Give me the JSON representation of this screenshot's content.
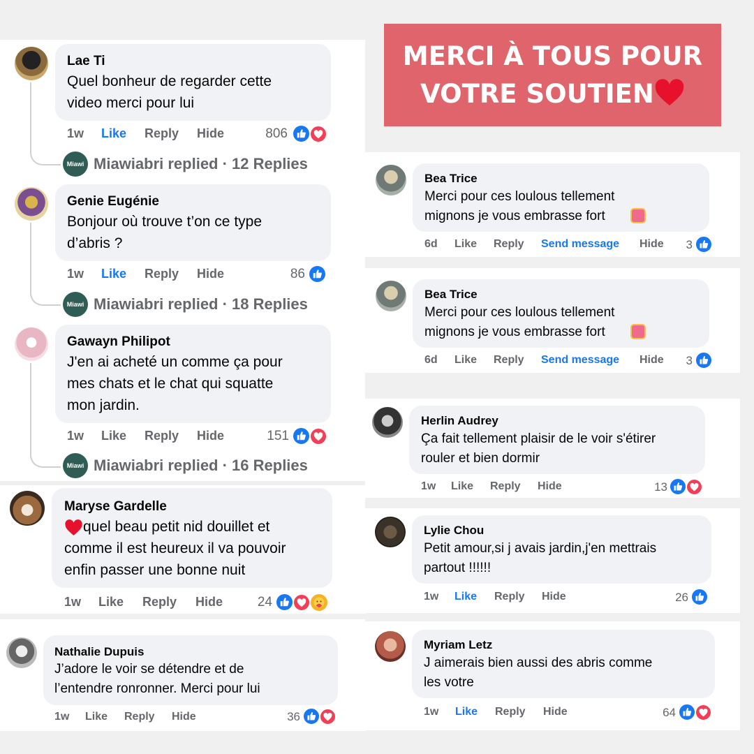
{
  "banner": {
    "line1": "MERCI À TOUS POUR",
    "line2": "VOTRE SOUTIEN",
    "heart_icon": "red-heart-emoji"
  },
  "comments": [
    {
      "name": "Lae Ti",
      "text": "Quel bonheur de regarder cette\nvideo merci pour lui",
      "time": "1w",
      "like": "Like",
      "reply": "Reply",
      "hide": "Hide",
      "count": "806",
      "reactions": [
        "like",
        "love"
      ],
      "replied": "Miawiabri replied · 12 Replies"
    },
    {
      "name": "Genie Eugénie",
      "text": "Bonjour où trouve t’on ce type\nd’abris ?",
      "time": "1w",
      "like": "Like",
      "reply": "Reply",
      "hide": "Hide",
      "count": "86",
      "reactions": [
        "like"
      ],
      "replied": "Miawiabri replied · 18 Replies"
    },
    {
      "name": "Gawayn Philipot",
      "text": "J'en ai acheté un comme ça pour\nmes chats et le chat qui squatte\nmon jardin.",
      "time": "1w",
      "like": "Like",
      "reply": "Reply",
      "hide": "Hide",
      "count": "151",
      "reactions": [
        "like",
        "love"
      ],
      "replied": "Miawiabri replied · 16 Replies"
    },
    {
      "name": "Maryse Gardelle",
      "text": "quel beau petit nid douillet et\ncomme il est heureux il va pouvoir\nenfin passer une bonne nuit",
      "time": "1w",
      "like": "Like",
      "reply": "Reply",
      "hide": "Hide",
      "count": "24",
      "reactions": [
        "like",
        "love",
        "care"
      ]
    },
    {
      "name": "Nathalie Dupuis",
      "text": "J’adore le voir se détendre et de\nl’entendre ronronner. Merci pour lui",
      "time": "1w",
      "like": "Like",
      "reply": "Reply",
      "hide": "Hide",
      "count": "36",
      "reactions": [
        "like",
        "love"
      ]
    },
    {
      "name": "Bea Trice",
      "text": "Merci pour ces loulous tellement\nmignons je vous embrasse fort",
      "time": "6d",
      "like": "Like",
      "reply": "Reply",
      "send": "Send message",
      "hide": "Hide",
      "count": "3",
      "reactions": [
        "like"
      ]
    },
    {
      "name": "Bea Trice",
      "text": "Merci pour ces loulous tellement\nmignons je vous embrasse fort",
      "time": "6d",
      "like": "Like",
      "reply": "Reply",
      "send": "Send message",
      "hide": "Hide",
      "count": "3",
      "reactions": [
        "like"
      ]
    },
    {
      "name": "Herlin Audrey",
      "text": "Ça fait tellement plaisir de le voir s'étirer\nrouler et bien dormir",
      "time": "1w",
      "like": "Like",
      "reply": "Reply",
      "hide": "Hide",
      "count": "13",
      "reactions": [
        "like",
        "love"
      ]
    },
    {
      "name": "Lylie Chou",
      "text": "Petit amour,si j avais jardin,j'en mettrais\npartout !!!!!!",
      "time": "1w",
      "like": "Like",
      "reply": "Reply",
      "hide": "Hide",
      "count": "26",
      "reactions": [
        "like"
      ]
    },
    {
      "name": "Myriam Letz",
      "text": "J aimerais bien aussi des abris comme\nles votre",
      "time": "1w",
      "like": "Like",
      "reply": "Reply",
      "hide": "Hide",
      "count": "64",
      "reactions": [
        "like",
        "love"
      ]
    }
  ],
  "colors": {
    "facebook_blue": "#1877f2",
    "love_red": "#f33e58",
    "banner_red": "#e0646b",
    "meta_gray": "#65676b",
    "bubble_gray": "#f0f2f5"
  },
  "page_avatar_label": "Miawi"
}
